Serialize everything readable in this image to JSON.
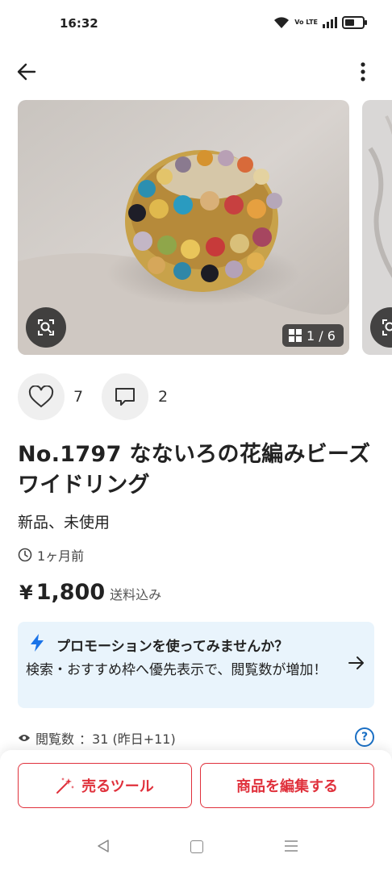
{
  "status_bar": {
    "time": "16:32",
    "lte_label": "Vo LTE",
    "battery_level": 0.6
  },
  "top_bar": {
    "back_icon": "arrow-left-icon",
    "menu_icon": "more-vertical-icon"
  },
  "gallery": {
    "counter": "1 / 6",
    "lens_icon": "image-search-icon"
  },
  "engagement": {
    "likes": "7",
    "comments": "2"
  },
  "product": {
    "title": "No.1797  なないろの花編みビーズワイドリング",
    "condition": "新品、未使用",
    "posted": "1ヶ月前",
    "currency": "¥",
    "price": "1,800",
    "shipping": "送料込み"
  },
  "promotion": {
    "title": "プロモーションを使ってみませんか？",
    "body": "検索・おすすめ枠へ優先表示で、閲覧数が増加！",
    "accent": "#1a73e8",
    "background": "#e9f4fc"
  },
  "stats": {
    "views_label": "閲覧数",
    "views_value": "：31 (昨日+11)",
    "help": "?"
  },
  "actions": {
    "sell_tool": "売るツール",
    "edit_item": "商品を編集する",
    "color": "#e0313c"
  }
}
